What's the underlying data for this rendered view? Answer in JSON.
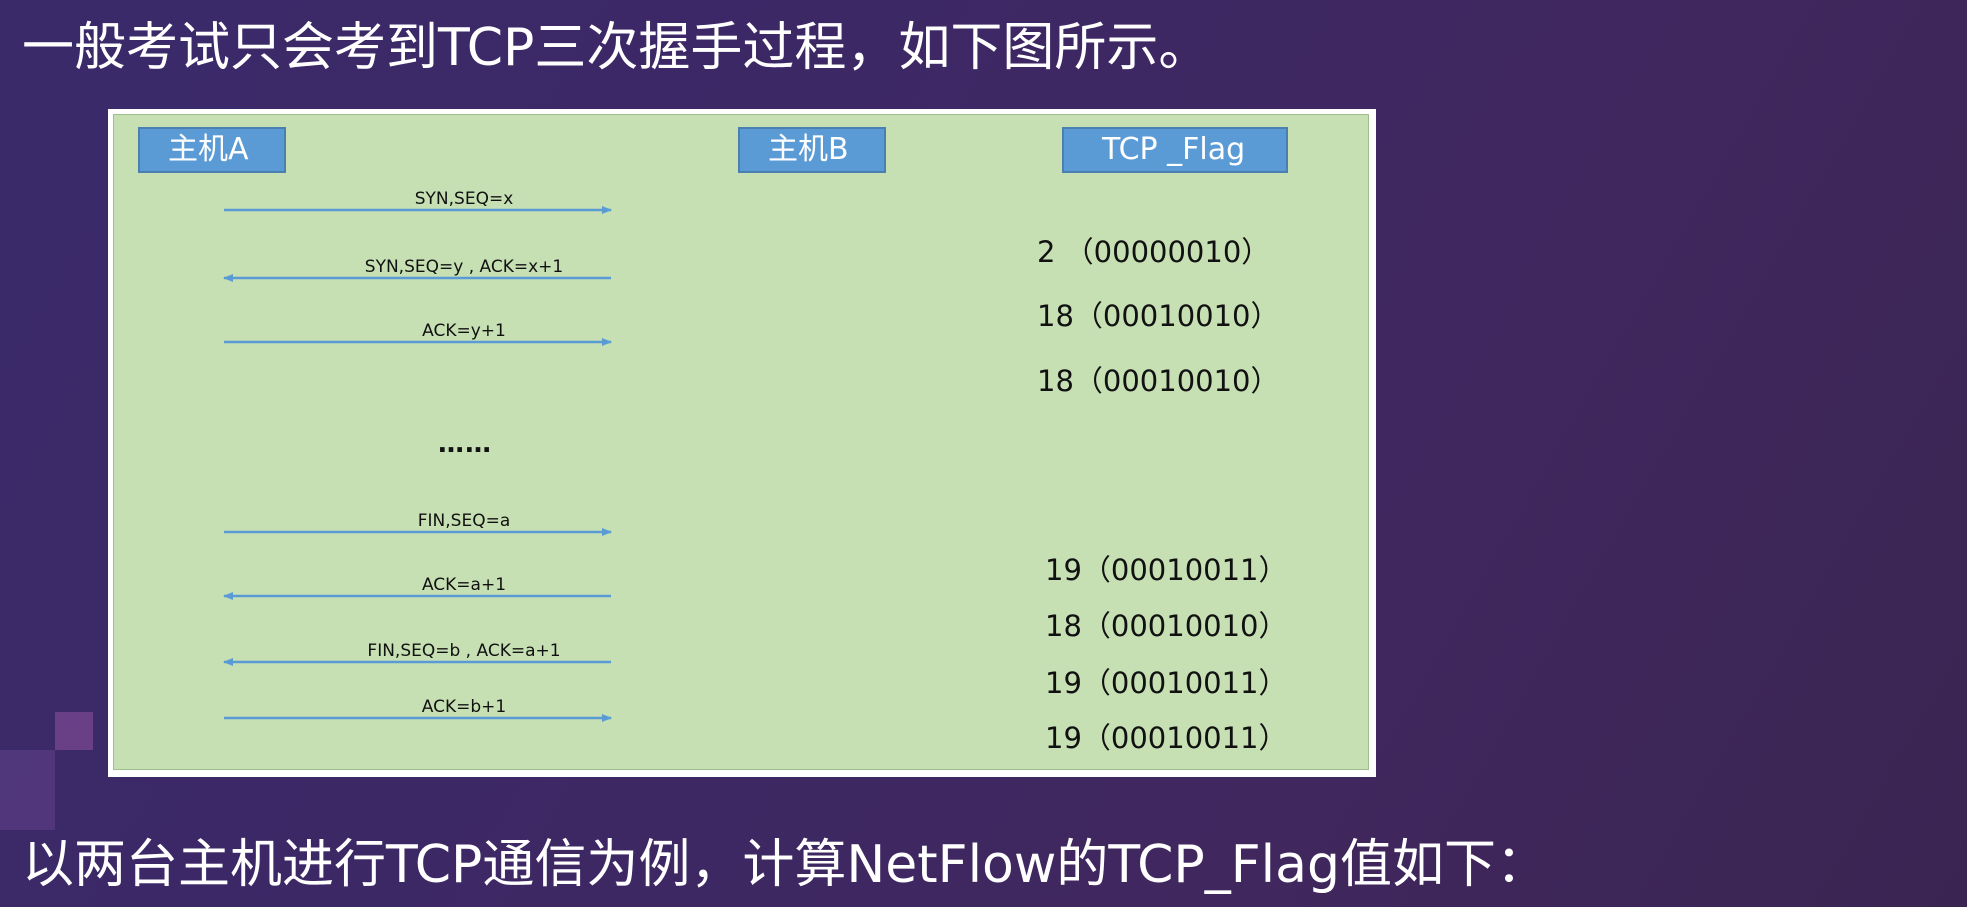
{
  "heading": "一般考试只会考到TCP三次握手过程，如下图所示。",
  "footer": "以两台主机进行TCP通信为例，计算NetFlow的TCP_Flag值如下：",
  "diagram": {
    "host_a": "主机A",
    "host_b": "主机B",
    "flag_header": "TCP _Flag",
    "ellipsis": "……",
    "messages": [
      {
        "label": "SYN,SEQ=x",
        "direction": "right"
      },
      {
        "label": "SYN,SEQ=y , ACK=x+1",
        "direction": "left"
      },
      {
        "label": "ACK=y+1",
        "direction": "right"
      },
      {
        "label": "FIN,SEQ=a",
        "direction": "right"
      },
      {
        "label": "ACK=a+1",
        "direction": "left"
      },
      {
        "label": "FIN,SEQ=b , ACK=a+1",
        "direction": "left"
      },
      {
        "label": "ACK=b+1",
        "direction": "right"
      }
    ],
    "flags": [
      "2 （00000010）",
      "18（00010010）",
      "18（00010010）",
      "19（00010011）",
      "18（00010010）",
      "19（00010011）",
      "19（00010011）"
    ],
    "arrow_color": "#5b9bd5"
  }
}
